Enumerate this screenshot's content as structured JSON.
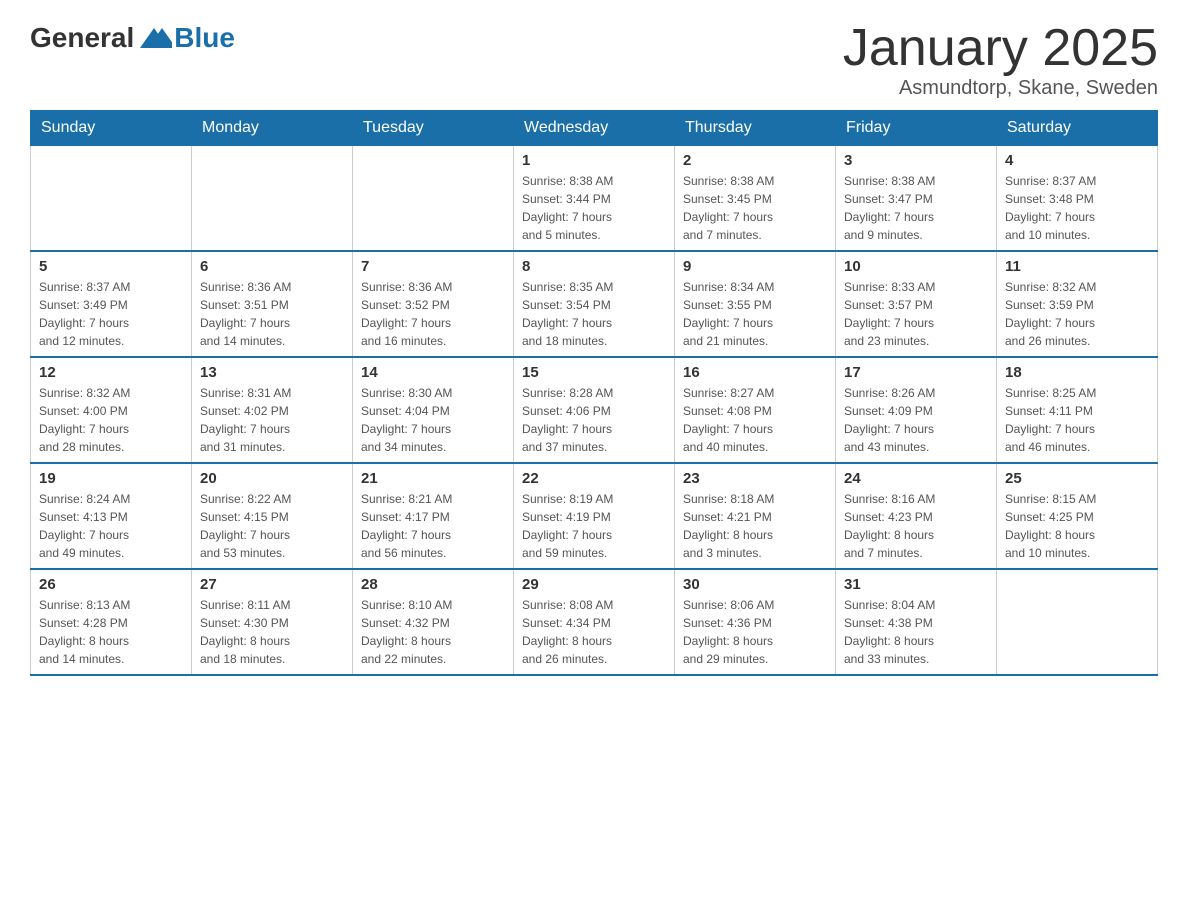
{
  "logo": {
    "text_general": "General",
    "text_blue": "Blue"
  },
  "title": "January 2025",
  "location": "Asmundtorp, Skane, Sweden",
  "days_of_week": [
    "Sunday",
    "Monday",
    "Tuesday",
    "Wednesday",
    "Thursday",
    "Friday",
    "Saturday"
  ],
  "weeks": [
    [
      {
        "day": "",
        "info": ""
      },
      {
        "day": "",
        "info": ""
      },
      {
        "day": "",
        "info": ""
      },
      {
        "day": "1",
        "info": "Sunrise: 8:38 AM\nSunset: 3:44 PM\nDaylight: 7 hours\nand 5 minutes."
      },
      {
        "day": "2",
        "info": "Sunrise: 8:38 AM\nSunset: 3:45 PM\nDaylight: 7 hours\nand 7 minutes."
      },
      {
        "day": "3",
        "info": "Sunrise: 8:38 AM\nSunset: 3:47 PM\nDaylight: 7 hours\nand 9 minutes."
      },
      {
        "day": "4",
        "info": "Sunrise: 8:37 AM\nSunset: 3:48 PM\nDaylight: 7 hours\nand 10 minutes."
      }
    ],
    [
      {
        "day": "5",
        "info": "Sunrise: 8:37 AM\nSunset: 3:49 PM\nDaylight: 7 hours\nand 12 minutes."
      },
      {
        "day": "6",
        "info": "Sunrise: 8:36 AM\nSunset: 3:51 PM\nDaylight: 7 hours\nand 14 minutes."
      },
      {
        "day": "7",
        "info": "Sunrise: 8:36 AM\nSunset: 3:52 PM\nDaylight: 7 hours\nand 16 minutes."
      },
      {
        "day": "8",
        "info": "Sunrise: 8:35 AM\nSunset: 3:54 PM\nDaylight: 7 hours\nand 18 minutes."
      },
      {
        "day": "9",
        "info": "Sunrise: 8:34 AM\nSunset: 3:55 PM\nDaylight: 7 hours\nand 21 minutes."
      },
      {
        "day": "10",
        "info": "Sunrise: 8:33 AM\nSunset: 3:57 PM\nDaylight: 7 hours\nand 23 minutes."
      },
      {
        "day": "11",
        "info": "Sunrise: 8:32 AM\nSunset: 3:59 PM\nDaylight: 7 hours\nand 26 minutes."
      }
    ],
    [
      {
        "day": "12",
        "info": "Sunrise: 8:32 AM\nSunset: 4:00 PM\nDaylight: 7 hours\nand 28 minutes."
      },
      {
        "day": "13",
        "info": "Sunrise: 8:31 AM\nSunset: 4:02 PM\nDaylight: 7 hours\nand 31 minutes."
      },
      {
        "day": "14",
        "info": "Sunrise: 8:30 AM\nSunset: 4:04 PM\nDaylight: 7 hours\nand 34 minutes."
      },
      {
        "day": "15",
        "info": "Sunrise: 8:28 AM\nSunset: 4:06 PM\nDaylight: 7 hours\nand 37 minutes."
      },
      {
        "day": "16",
        "info": "Sunrise: 8:27 AM\nSunset: 4:08 PM\nDaylight: 7 hours\nand 40 minutes."
      },
      {
        "day": "17",
        "info": "Sunrise: 8:26 AM\nSunset: 4:09 PM\nDaylight: 7 hours\nand 43 minutes."
      },
      {
        "day": "18",
        "info": "Sunrise: 8:25 AM\nSunset: 4:11 PM\nDaylight: 7 hours\nand 46 minutes."
      }
    ],
    [
      {
        "day": "19",
        "info": "Sunrise: 8:24 AM\nSunset: 4:13 PM\nDaylight: 7 hours\nand 49 minutes."
      },
      {
        "day": "20",
        "info": "Sunrise: 8:22 AM\nSunset: 4:15 PM\nDaylight: 7 hours\nand 53 minutes."
      },
      {
        "day": "21",
        "info": "Sunrise: 8:21 AM\nSunset: 4:17 PM\nDaylight: 7 hours\nand 56 minutes."
      },
      {
        "day": "22",
        "info": "Sunrise: 8:19 AM\nSunset: 4:19 PM\nDaylight: 7 hours\nand 59 minutes."
      },
      {
        "day": "23",
        "info": "Sunrise: 8:18 AM\nSunset: 4:21 PM\nDaylight: 8 hours\nand 3 minutes."
      },
      {
        "day": "24",
        "info": "Sunrise: 8:16 AM\nSunset: 4:23 PM\nDaylight: 8 hours\nand 7 minutes."
      },
      {
        "day": "25",
        "info": "Sunrise: 8:15 AM\nSunset: 4:25 PM\nDaylight: 8 hours\nand 10 minutes."
      }
    ],
    [
      {
        "day": "26",
        "info": "Sunrise: 8:13 AM\nSunset: 4:28 PM\nDaylight: 8 hours\nand 14 minutes."
      },
      {
        "day": "27",
        "info": "Sunrise: 8:11 AM\nSunset: 4:30 PM\nDaylight: 8 hours\nand 18 minutes."
      },
      {
        "day": "28",
        "info": "Sunrise: 8:10 AM\nSunset: 4:32 PM\nDaylight: 8 hours\nand 22 minutes."
      },
      {
        "day": "29",
        "info": "Sunrise: 8:08 AM\nSunset: 4:34 PM\nDaylight: 8 hours\nand 26 minutes."
      },
      {
        "day": "30",
        "info": "Sunrise: 8:06 AM\nSunset: 4:36 PM\nDaylight: 8 hours\nand 29 minutes."
      },
      {
        "day": "31",
        "info": "Sunrise: 8:04 AM\nSunset: 4:38 PM\nDaylight: 8 hours\nand 33 minutes."
      },
      {
        "day": "",
        "info": ""
      }
    ]
  ]
}
